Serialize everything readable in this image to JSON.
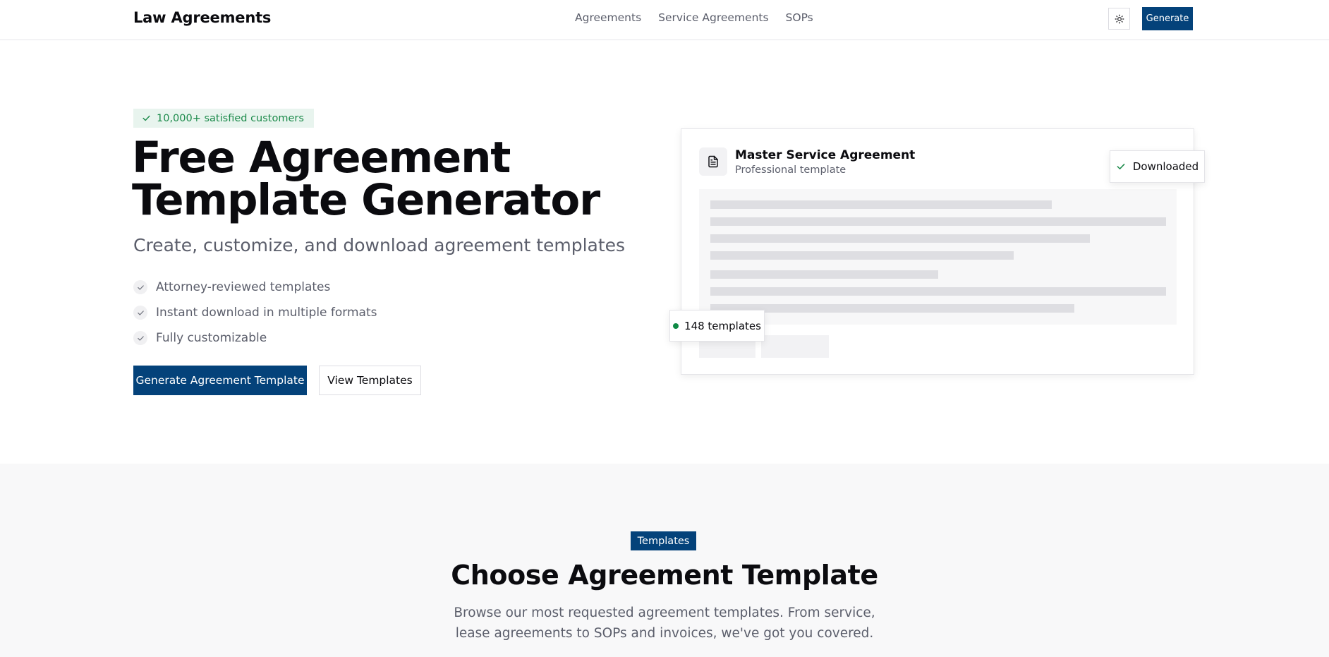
{
  "header": {
    "brand": "Law Agreements",
    "nav": [
      "Agreements",
      "Service Agreements",
      "SOPs"
    ],
    "theme_icon": "sun-icon",
    "generate_label": "Generate"
  },
  "hero": {
    "badge": "10,000+ satisfied customers",
    "title_line1": "Free Agreement",
    "title_line2": "Template Generator",
    "subtitle": "Create, customize, and download agreement templates",
    "features": [
      "Attorney-reviewed templates",
      "Instant download in multiple formats",
      "Fully customizable"
    ],
    "primary_cta": "Generate Agreement Template",
    "secondary_cta": "View Templates"
  },
  "doc_card": {
    "icon": "document-icon",
    "title": "Master Service Agreement",
    "subtitle": "Professional template",
    "downloaded_label": "Downloaded",
    "templates_count_label": "148 templates"
  },
  "templates_section": {
    "tag": "Templates",
    "title": "Choose Agreement Template",
    "description": "Browse our most requested agreement templates. From service, lease agreements to SOPs and invoices, we've got you covered."
  },
  "colors": {
    "primary": "#04427a",
    "success": "#1b8a4a",
    "muted_text": "#5b5e6b",
    "section_bg": "#f8f8f9"
  }
}
